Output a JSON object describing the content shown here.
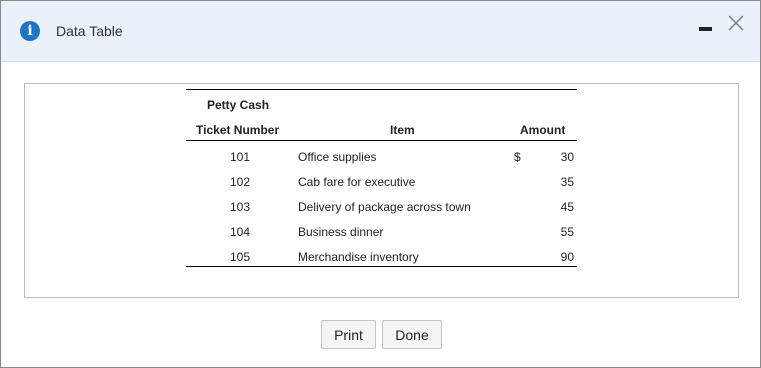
{
  "window": {
    "title": "Data Table",
    "info_icon": "info-icon",
    "minimize_icon": "minimize-icon",
    "close_icon": "close-icon",
    "accent_color": "#1f73c7"
  },
  "table": {
    "group_header": "Petty Cash",
    "columns": [
      "Ticket Number",
      "Item",
      "Amount"
    ],
    "currency_symbol": "$",
    "rows": [
      {
        "ticket": "101",
        "item": "Office supplies",
        "amount": "30"
      },
      {
        "ticket": "102",
        "item": "Cab fare for executive",
        "amount": "35"
      },
      {
        "ticket": "103",
        "item": "Delivery of package across town",
        "amount": "45"
      },
      {
        "ticket": "104",
        "item": "Business dinner",
        "amount": "55"
      },
      {
        "ticket": "105",
        "item": "Merchandise inventory",
        "amount": "90"
      }
    ]
  },
  "buttons": {
    "print": "Print",
    "done": "Done"
  }
}
